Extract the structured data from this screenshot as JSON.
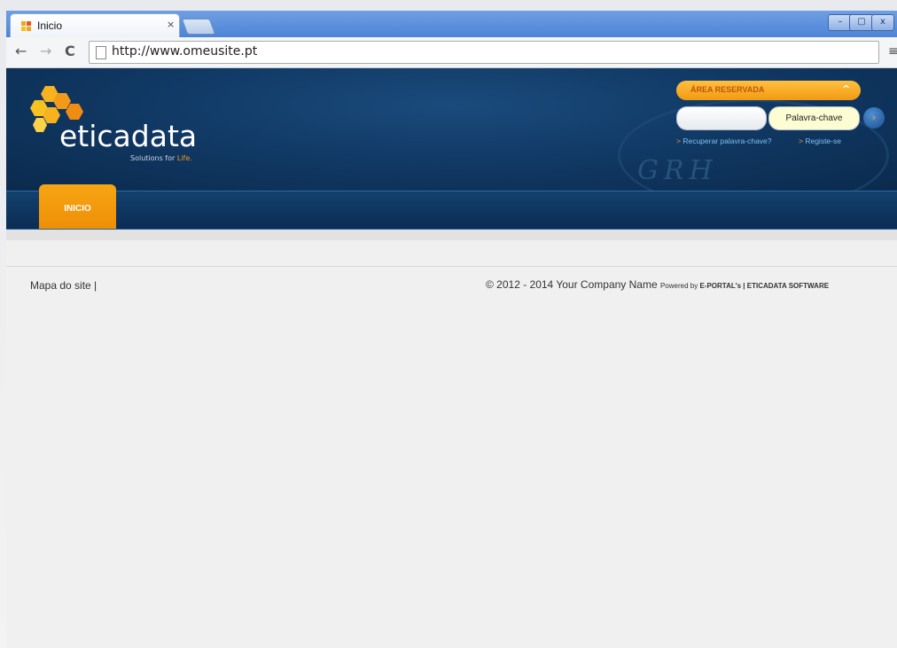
{
  "browser": {
    "tab_title": "Inicio",
    "tab_close": "×",
    "url": "http://www.omeusite.pt",
    "controls": {
      "minimize": "–",
      "maximize": "▢",
      "close": "x"
    },
    "nav": {
      "back": "←",
      "forward": "→",
      "reload": "C",
      "menu": "≡"
    }
  },
  "site": {
    "logo_name": "eticadata",
    "tagline_prefix": "Solutions for ",
    "tagline_highlight": "Life.",
    "watermark": "GRH",
    "reserved_area": {
      "title": "ÁREA RESERVADA",
      "chevron": "^",
      "username_value": "",
      "password_placeholder": "Palavra-chave",
      "go_symbol": "›",
      "recover_arrow": ">",
      "recover_label": "Recuperar palavra-chave?",
      "register_arrow": ">",
      "register_label": "Registe-se"
    },
    "nav_tab": "INICIO",
    "footer": {
      "sitemap": "Mapa do site |",
      "copyright": "© 2012 - 2014 Your Company Name ",
      "powered_by": "Powered by ",
      "powered_brand": "E-PORTAL's | ETICADATA SOFTWARE"
    }
  },
  "colors": {
    "accent_orange": "#f29a12",
    "header_blue": "#113a66",
    "tab_blue": "#4d84d6"
  }
}
